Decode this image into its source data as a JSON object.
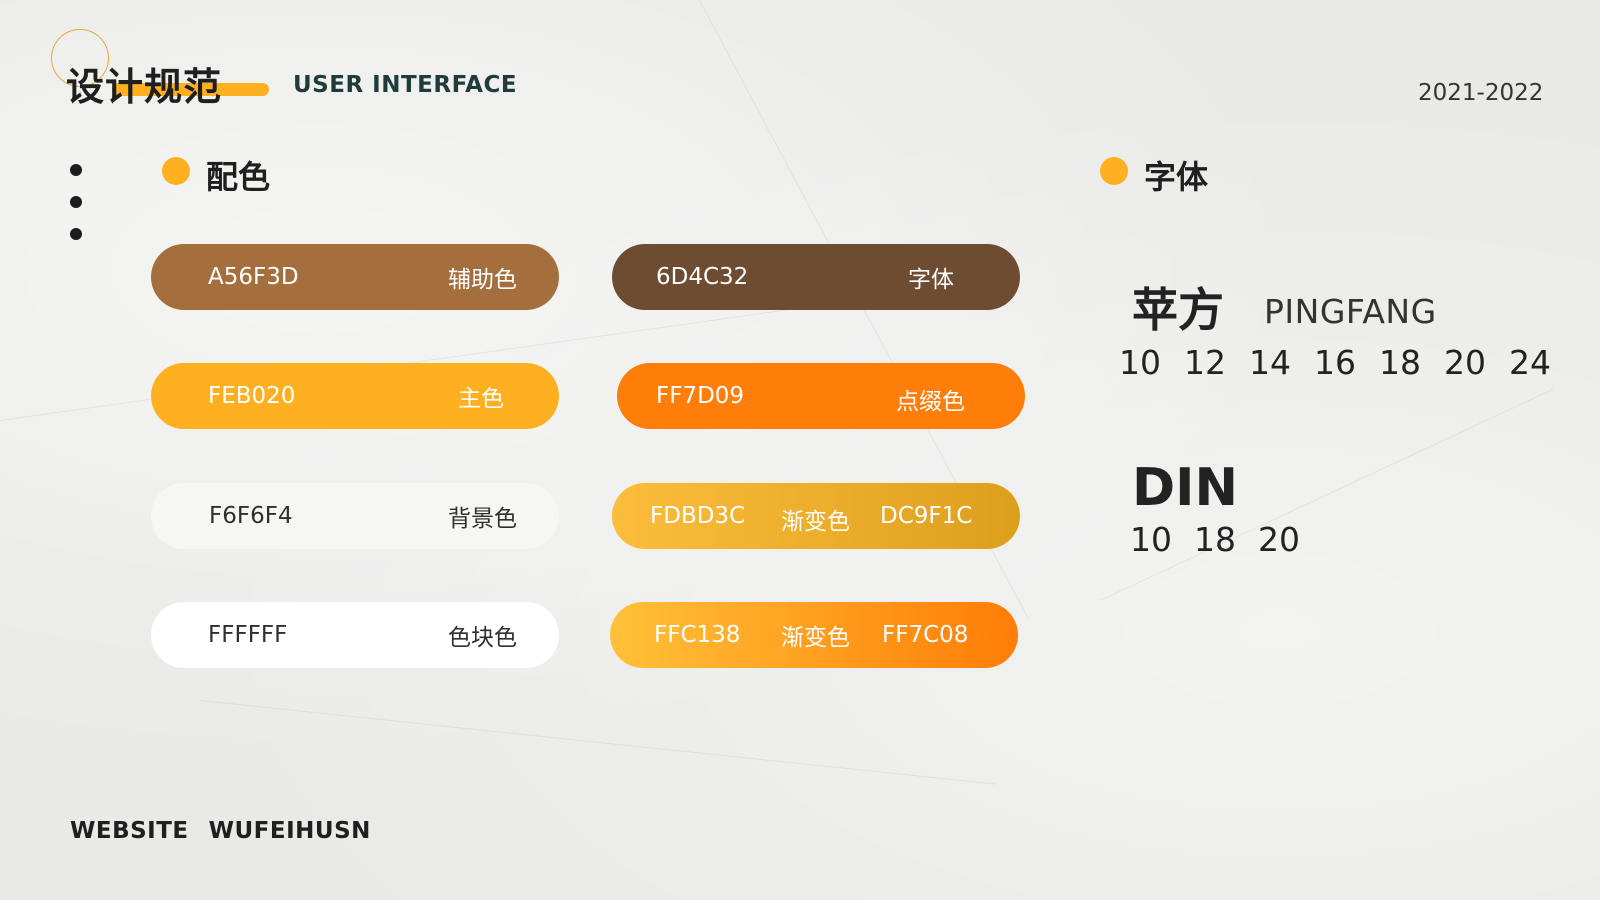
{
  "header": {
    "title": "设计规范",
    "subtitle": "USER INTERFACE",
    "year": "2021-2022"
  },
  "colors_section": {
    "title": "配色",
    "swatches": [
      {
        "code": "A56F3D",
        "label": "辅助色",
        "bg": "#a56f3d",
        "text": "#ffffff"
      },
      {
        "code": "6D4C32",
        "label": "字体",
        "bg": "#6d4c32",
        "text": "#ffffff"
      },
      {
        "code": "FEB020",
        "label": "主色",
        "bg": "#feb020",
        "text": "#ffffff"
      },
      {
        "code": "FF7D09",
        "label": "点缀色",
        "bg": "#ff7d09",
        "text": "#ffffff"
      },
      {
        "code": "F6F6F4",
        "label": "背景色",
        "bg": "#f6f6f4",
        "text": "#2f2f2f"
      },
      {
        "code": "FDBD3C",
        "label": "渐变色",
        "code2": "DC9F1C",
        "bg_from": "#fdbd3c",
        "bg_to": "#dc9f1c",
        "text": "#ffffff"
      },
      {
        "code": "FFFFFF",
        "label": "色块色",
        "bg": "#ffffff",
        "text": "#2f2f2f"
      },
      {
        "code": "FFC138",
        "label": "渐变色",
        "code2": "FF7C08",
        "bg_from": "#ffc138",
        "bg_to": "#ff7c08",
        "text": "#ffffff"
      }
    ]
  },
  "fonts_section": {
    "title": "字体",
    "pingfang": {
      "name": "苹方",
      "name_en": "PINGFANG",
      "sizes": [
        "10",
        "12",
        "14",
        "16",
        "18",
        "20",
        "24"
      ]
    },
    "din": {
      "name": "DIN",
      "sizes": [
        "10",
        "18",
        "20"
      ]
    }
  },
  "footer": {
    "label": "WEBSITE",
    "value": "WUFEIHUSN"
  },
  "accent_color": "#feb020"
}
